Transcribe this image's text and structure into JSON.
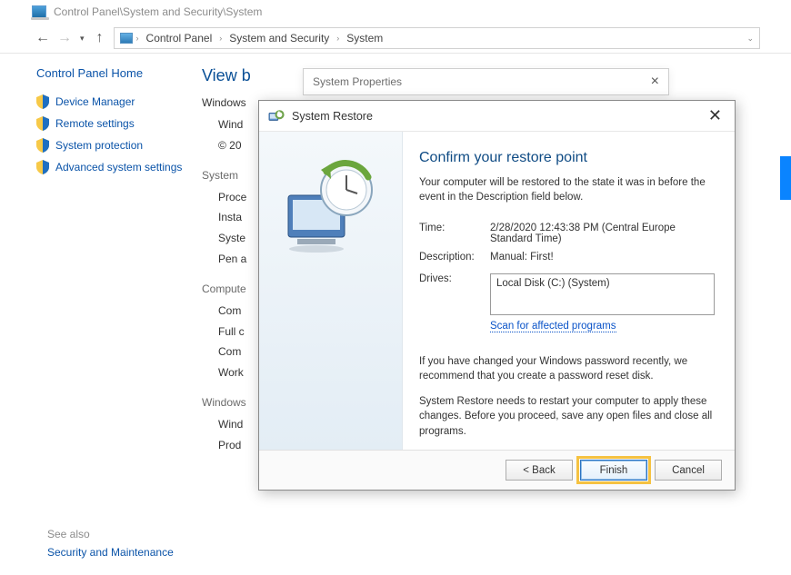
{
  "title_path": "Control Panel\\System and Security\\System",
  "breadcrumb": [
    "Control Panel",
    "System and Security",
    "System"
  ],
  "left": {
    "home": "Control Panel Home",
    "links": [
      "Device Manager",
      "Remote settings",
      "System protection",
      "Advanced system settings"
    ],
    "see_also": "See also",
    "sec": "Security and Maintenance"
  },
  "main": {
    "view_header": "View b",
    "win_edition": "Windows",
    "win_line": "Wind",
    "copyright": "© 20",
    "sys_group": "System",
    "sys_items": [
      "Proce",
      "Insta",
      "Syste",
      "Pen a"
    ],
    "comp_group": "Compute",
    "comp_items": [
      "Com",
      "Full c",
      "Com",
      "Work"
    ],
    "act_group": "Windows",
    "act_items": [
      "Wind",
      "Prod"
    ]
  },
  "sysprops": {
    "title": "System Properties"
  },
  "wizard": {
    "titlebar": "System Restore",
    "heading": "Confirm your restore point",
    "desc": "Your computer will be restored to the state it was in before the event in the Description field below.",
    "time_label": "Time:",
    "time_value": "2/28/2020 12:43:38 PM (Central Europe Standard Time)",
    "descr_label": "Description:",
    "descr_value": "Manual: First!",
    "drives_label": "Drives:",
    "drives_value": "Local Disk (C:) (System)",
    "scan": "Scan for affected programs",
    "para1": "If you have changed your Windows password recently, we recommend that you create a password reset disk.",
    "para2": "System Restore needs to restart your computer to apply these changes. Before you proceed, save any open files and close all programs.",
    "back": "< Back",
    "finish": "Finish",
    "cancel": "Cancel"
  }
}
